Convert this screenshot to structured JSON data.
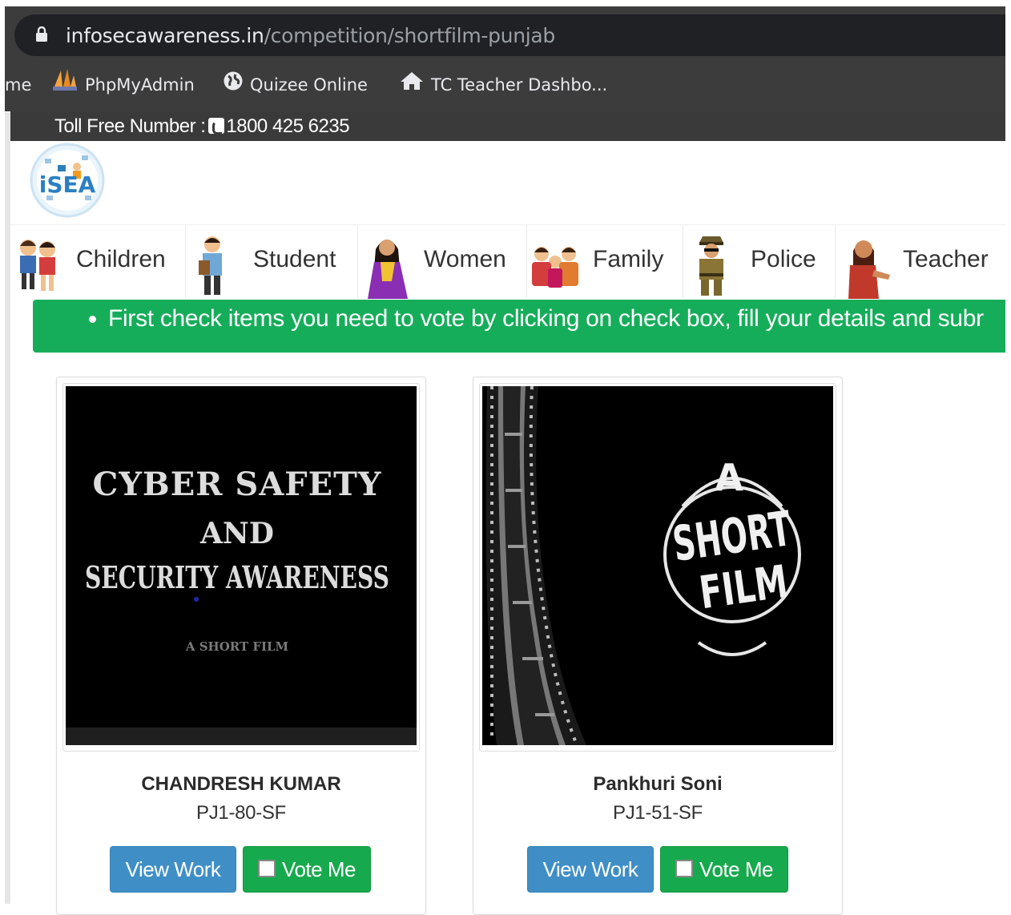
{
  "browser": {
    "url_domain": "infosecawareness.in",
    "url_path": "/competition/shortfilm-punjab",
    "bookmarks": [
      {
        "label": "me",
        "icon": "none"
      },
      {
        "label": "PhpMyAdmin",
        "icon": "phpmyadmin-sail-icon"
      },
      {
        "label": "Quizee  Online",
        "icon": "globe-icon"
      },
      {
        "label": "TC Teacher Dashbo...",
        "icon": "home-icon"
      }
    ]
  },
  "topbar": {
    "toll_free_label": "Toll Free Number :",
    "toll_free_number": "1800 425 6235"
  },
  "logo": {
    "text": "iSEA"
  },
  "nav": {
    "items": [
      {
        "label": "Children",
        "icon": "children-avatar-icon"
      },
      {
        "label": "Student",
        "icon": "student-avatar-icon"
      },
      {
        "label": "Women",
        "icon": "women-avatar-icon"
      },
      {
        "label": "Family",
        "icon": "family-avatar-icon"
      },
      {
        "label": "Police",
        "icon": "police-avatar-icon"
      },
      {
        "label": "Teacher",
        "icon": "teacher-avatar-icon"
      }
    ]
  },
  "notice": {
    "text": "First check items you need to vote by clicking on check box, fill your details and subr"
  },
  "entries": [
    {
      "name": "CHANDRESH KUMAR",
      "code": "PJ1-80-SF",
      "thumb_lines": [
        "CYBER SAFETY",
        "AND",
        "SECURITY AWARENESS"
      ],
      "thumb_sub": "A SHORT FILM",
      "view_label": "View Work",
      "vote_label": "Vote Me"
    },
    {
      "name": "Pankhuri Soni",
      "code": "PJ1-51-SF",
      "thumb_lines": [
        "A",
        "SHORT",
        "FILM"
      ],
      "view_label": "View Work",
      "vote_label": "Vote Me"
    }
  ],
  "colors": {
    "notice_green": "#16ad5a",
    "view_blue": "#3f8fc6",
    "vote_green": "#17a94d",
    "topbar_dark": "#3a3a3a"
  }
}
